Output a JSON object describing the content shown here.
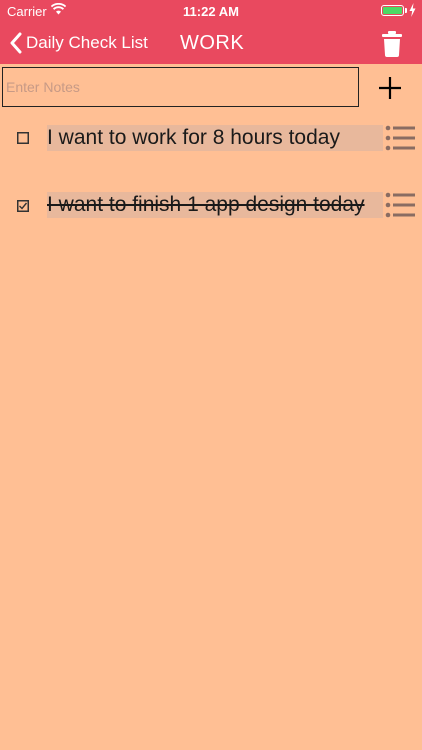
{
  "status_bar": {
    "carrier": "Carrier",
    "time": "11:22 AM",
    "icons": [
      "wifi-icon",
      "battery-icon",
      "charging-icon"
    ]
  },
  "nav": {
    "back_label": "Daily Check List",
    "title": "WORK",
    "back_icon": "chevron-left-icon",
    "action_icon": "trash-icon"
  },
  "notes_input": {
    "value": "",
    "placeholder": "Enter Notes"
  },
  "add_icon": "plus-icon",
  "tasks": [
    {
      "text": "I want to work for 8 hours today",
      "checked": false,
      "menu_icon": "list-icon"
    },
    {
      "text": "I want to finish 1 app design today",
      "checked": true,
      "menu_icon": "list-icon"
    }
  ],
  "colors": {
    "header": "#E9495F",
    "background": "#FFBF94",
    "task_highlight": "#E8B89C",
    "battery": "#4CD964"
  }
}
